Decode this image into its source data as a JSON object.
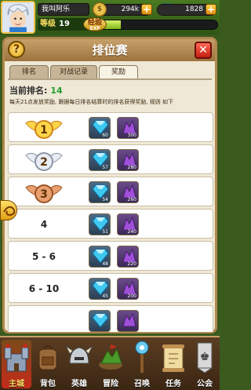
{
  "player": {
    "name": "我叫阿乐",
    "level_label": "等级",
    "level": "19",
    "exp_label": "经验",
    "exp_sub": "EXP",
    "exp_fraction": 0.22
  },
  "currency": {
    "coins": "294k",
    "gems": "1828"
  },
  "panel": {
    "title": "排位赛",
    "tabs": [
      {
        "label": "排名",
        "active": false
      },
      {
        "label": "对战记录",
        "active": false
      },
      {
        "label": "奖励",
        "active": true
      }
    ],
    "current_rank_label": "当前排名:",
    "current_rank": "14",
    "description": "每天21点发放奖励, 跟据每日排名结算时的排名获得奖励, 规则 如下"
  },
  "rewards": [
    {
      "rank": "1",
      "badge": "gold",
      "gems": "60",
      "crystals": "300"
    },
    {
      "rank": "2",
      "badge": "silver",
      "gems": "57",
      "crystals": "280"
    },
    {
      "rank": "3",
      "badge": "bronze",
      "gems": "54",
      "crystals": "260"
    },
    {
      "rank": "4",
      "badge": "",
      "gems": "51",
      "crystals": "240"
    },
    {
      "rank": "5 - 6",
      "badge": "",
      "gems": "48",
      "crystals": "220"
    },
    {
      "rank": "6 - 10",
      "badge": "",
      "gems": "45",
      "crystals": "200"
    },
    {
      "rank": "",
      "badge": "",
      "gems": "",
      "crystals": ""
    }
  ],
  "nav": [
    {
      "label": "主城",
      "icon": "castle-icon",
      "active": true
    },
    {
      "label": "背包",
      "icon": "backpack-icon",
      "active": false
    },
    {
      "label": "英雄",
      "icon": "hero-helmet-icon",
      "active": false
    },
    {
      "label": "冒险",
      "icon": "adventure-island-icon",
      "active": false
    },
    {
      "label": "召唤",
      "icon": "summon-staff-icon",
      "active": false
    },
    {
      "label": "任务",
      "icon": "quest-scroll-icon",
      "active": false
    },
    {
      "label": "公会",
      "icon": "guild-banner-icon",
      "active": false
    }
  ],
  "colors": {
    "rank_value": "#1e9e2a",
    "gem": "#3fc8f0",
    "crystal": "#a050d8"
  }
}
